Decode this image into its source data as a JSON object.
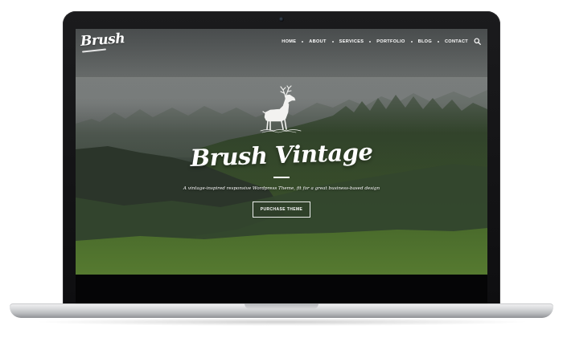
{
  "site": {
    "logo_text": "Brush",
    "nav": {
      "items": [
        {
          "label": "HOME"
        },
        {
          "label": "ABOUT"
        },
        {
          "label": "SERVICES"
        },
        {
          "label": "PORTFOLIO"
        },
        {
          "label": "BLOG"
        },
        {
          "label": "CONTACT"
        }
      ],
      "search_icon": "search-icon"
    },
    "hero": {
      "emblem_icon": "deer-icon",
      "title": "Brush Vintage",
      "tagline": "A vintage-inspired responsive Wordpress Theme, fit for a great business-based design",
      "cta_label": "PURCHASE THEME"
    }
  },
  "colors": {
    "text": "#ffffff",
    "bezel": "#111113",
    "forest_dark": "#2f3b2c",
    "grass": "#4b6b2d"
  }
}
